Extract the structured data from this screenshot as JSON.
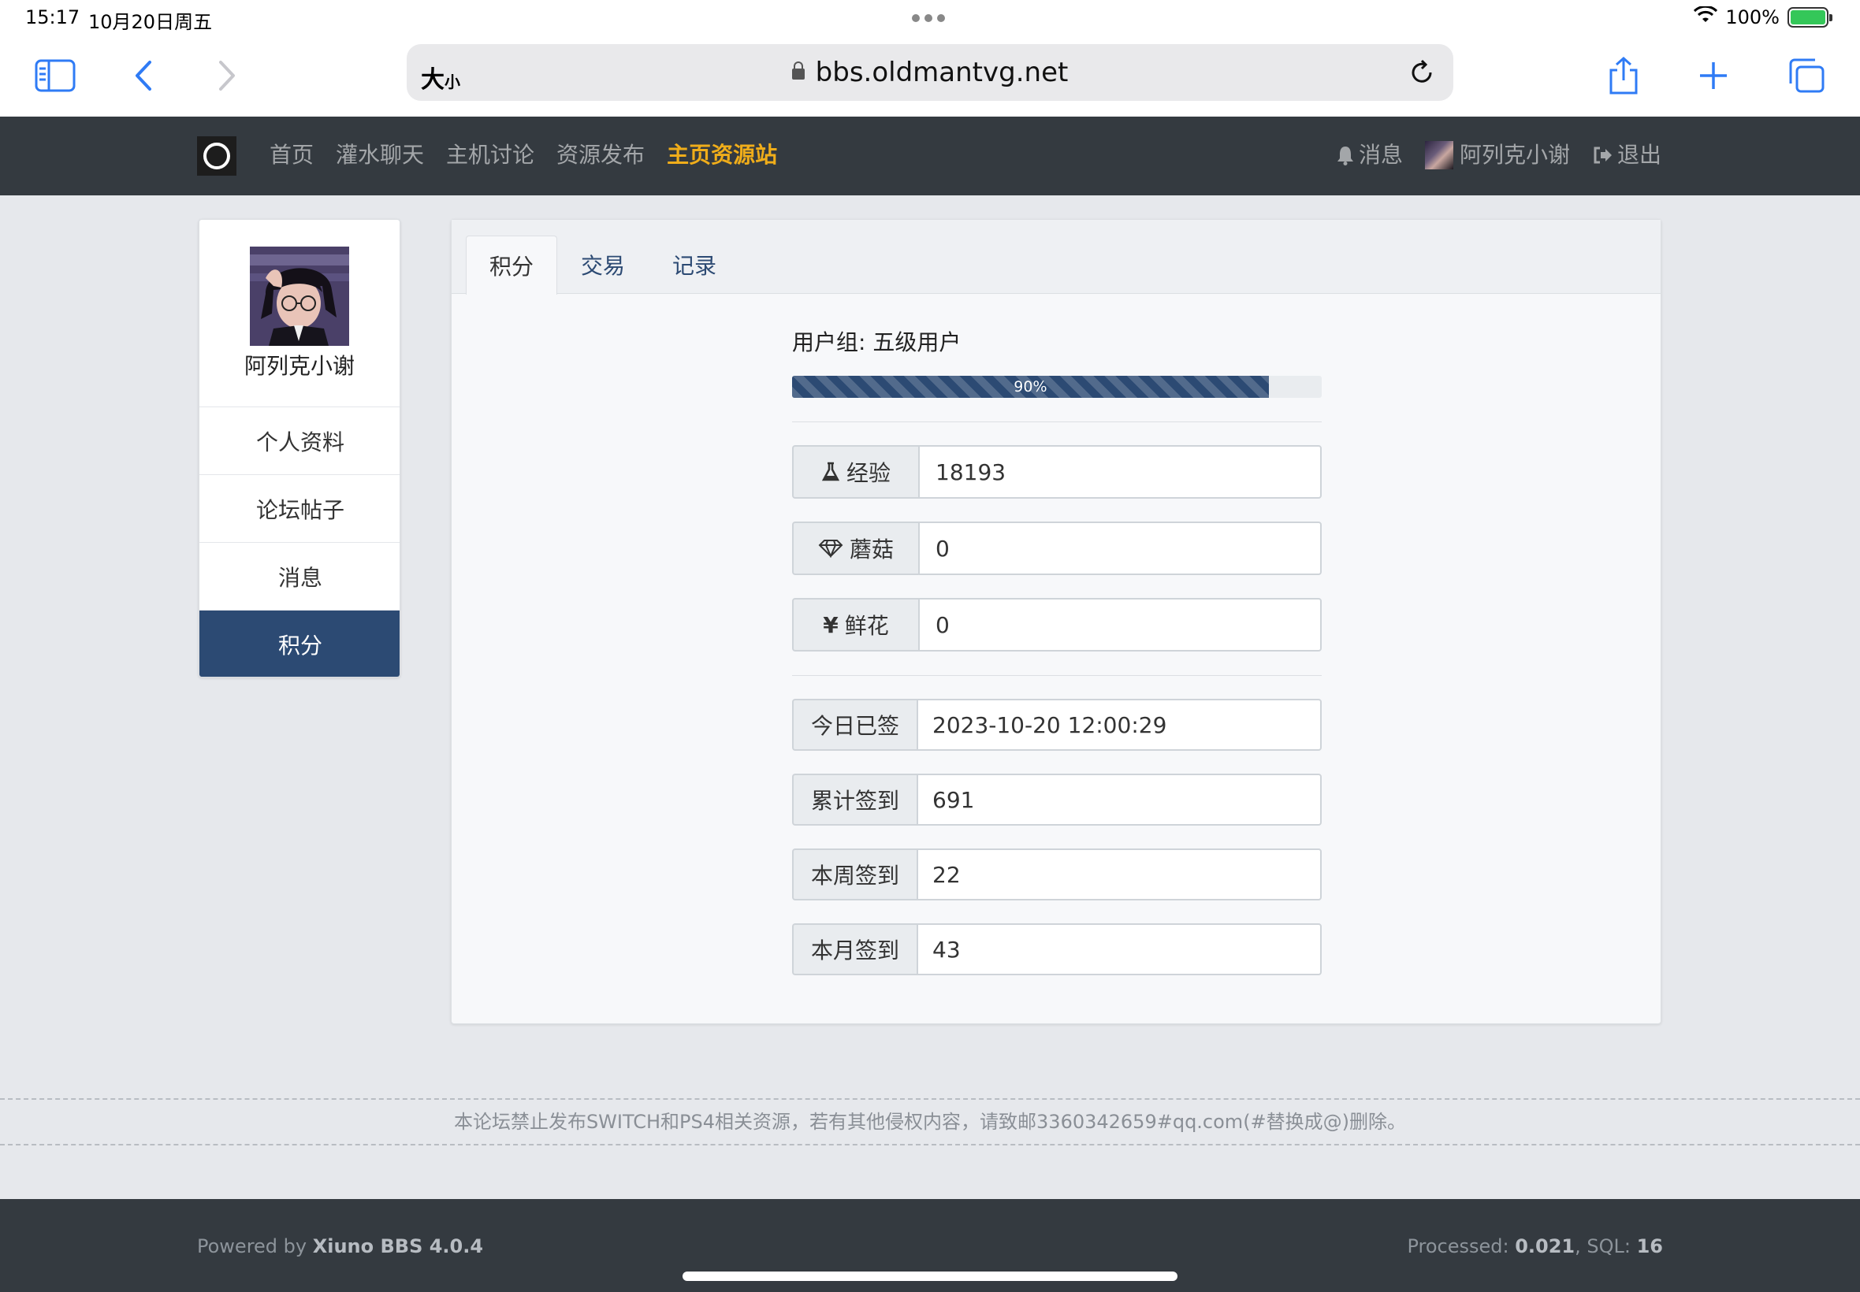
{
  "status_bar": {
    "time": "15:17",
    "date": "10月20日周五",
    "battery": "100%"
  },
  "browser": {
    "text_size_label": "大",
    "text_size_small": "小",
    "host": "bbs.oldmantvg.net"
  },
  "site_nav": {
    "links": [
      "首页",
      "灌水聊天",
      "主机讨论",
      "资源发布",
      "主页资源站"
    ],
    "messages_label": "消息",
    "username": "阿列克小谢",
    "logout_label": "退出",
    "highlight_color": "#f0ad1a"
  },
  "sidebar": {
    "username": "阿列克小谢",
    "items": [
      "个人资料",
      "论坛帖子",
      "消息",
      "积分"
    ],
    "active_index": 3,
    "active_color": "#2c4a73"
  },
  "tabs": [
    "积分",
    "交易",
    "记录"
  ],
  "points": {
    "group_label": "用户组: 五级用户",
    "progress_percent": 90,
    "progress_text": "90%",
    "currency": [
      {
        "icon": "flask-icon",
        "label": "经验",
        "value": "18193"
      },
      {
        "icon": "diamond-icon",
        "label": "蘑菇",
        "value": "0"
      },
      {
        "icon": "yen-icon",
        "label": "鲜花",
        "value": "0",
        "icon_glyph": "¥"
      }
    ],
    "signin": [
      {
        "label": "今日已签",
        "value": "2023-10-20 12:00:29"
      },
      {
        "label": "累计签到",
        "value": "691"
      },
      {
        "label": "本周签到",
        "value": "22"
      },
      {
        "label": "本月签到",
        "value": "43"
      }
    ]
  },
  "footer": {
    "notice": "本论坛禁止发布SWITCH和PS4相关资源，若有其他侵权内容，请致邮3360342659#qq.com(#替换成@)删除。",
    "powered_prefix": "Powered by ",
    "powered_name": "Xiuno BBS 4.0.4",
    "processed_label": "Processed: ",
    "processed_value": "0.021",
    "sql_label": ", SQL: ",
    "sql_value": "16"
  }
}
